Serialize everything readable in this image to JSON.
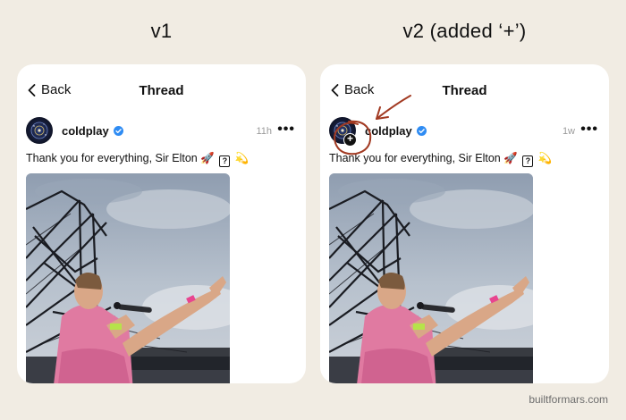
{
  "versions": [
    {
      "title": "v1",
      "nav": {
        "back_label": "Back",
        "title": "Thread"
      },
      "post": {
        "username": "coldplay",
        "time": "11h",
        "caption_before": "Thank you for everything, Sir Elton",
        "rocket": "🚀",
        "box_glyph": "?",
        "comet": "💫"
      }
    },
    {
      "title": "v2 (added ‘+’)",
      "nav": {
        "back_label": "Back",
        "title": "Thread"
      },
      "post": {
        "username": "coldplay",
        "time": "1w",
        "plus_label": "+",
        "caption_before": "Thank you for everything, Sir Elton",
        "rocket": "🚀",
        "box_glyph": "?",
        "comet": "💫"
      }
    }
  ],
  "watermark": "builtformars.com",
  "colors": {
    "background": "#f1ece3",
    "annotation": "#a23a22",
    "verified": "#2f8cf3",
    "wristband_pink": "#e8458f",
    "wristband_green": "#b6e34a"
  },
  "icons": [
    "chevron-left-icon",
    "verified-badge-icon",
    "more-icon",
    "plus-badge-icon",
    "annotation-arrow-icon"
  ]
}
